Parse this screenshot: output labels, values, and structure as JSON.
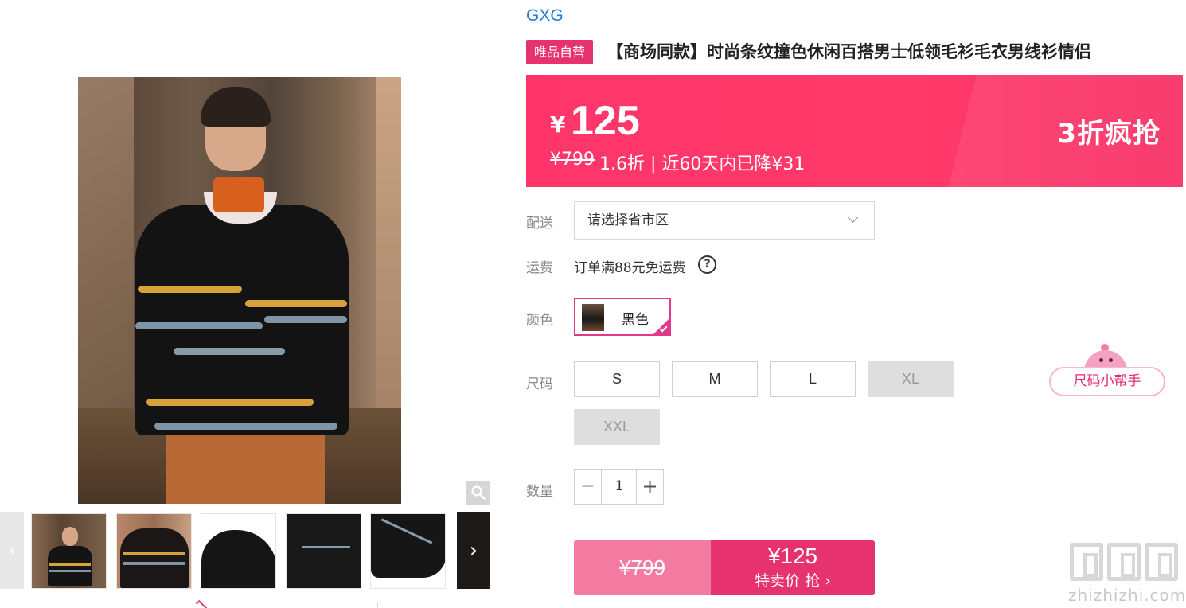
{
  "brand": "GXG",
  "product": {
    "badge": "唯品自营",
    "title": "【商场同款】时尚条纹撞色休闲百搭男士低领毛衫毛衣男线衫情侣"
  },
  "price": {
    "currency": "¥",
    "current": "125",
    "original": "¥799",
    "meta": "1.6折 | 近60天内已降¥31",
    "promo": "3折疯抢",
    "accent_color": "#ff356a"
  },
  "delivery": {
    "label": "配送",
    "placeholder": "请选择省市区"
  },
  "shipping": {
    "label": "运费",
    "text": "订单满88元免运费",
    "help_icon": "?"
  },
  "color": {
    "label": "颜色",
    "selected": "黑色"
  },
  "size": {
    "label": "尺码",
    "options": [
      {
        "label": "S",
        "available": true
      },
      {
        "label": "M",
        "available": true
      },
      {
        "label": "L",
        "available": true
      },
      {
        "label": "XL",
        "available": false
      },
      {
        "label": "XXL",
        "available": false
      }
    ],
    "helper": "尺码小帮手"
  },
  "quantity": {
    "label": "数量",
    "minus": "−",
    "value": "1",
    "plus": "+"
  },
  "buy": {
    "original": "¥799",
    "price": "¥125",
    "label": "特卖价 抢 ›",
    "color": "#e6336f"
  },
  "gallery": {
    "prev_icon": "‹",
    "next_icon": "›",
    "zoom_icon": "magnifier-icon"
  },
  "watermark": {
    "text": "zhizhizhi.com"
  }
}
